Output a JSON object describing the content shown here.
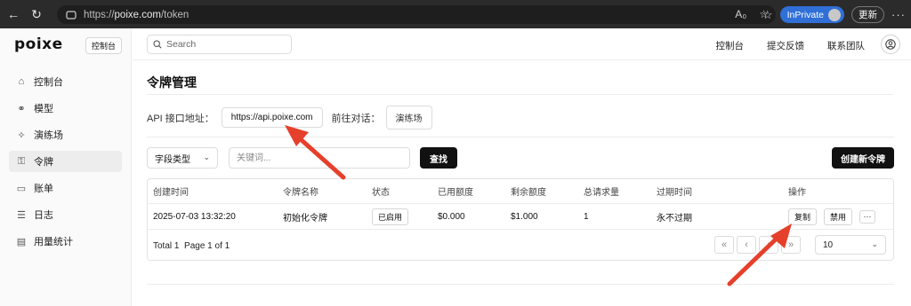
{
  "browser": {
    "url_scheme": "https://",
    "url_host": "poixe.com",
    "url_path": "/token",
    "inprivate_label": "InPrivate",
    "update_label": "更新"
  },
  "app": {
    "logo": "poixe",
    "console_badge": "控制台"
  },
  "sidebar": {
    "items": [
      {
        "label": "控制台",
        "icon": "home-icon"
      },
      {
        "label": "模型",
        "icon": "models-icon"
      },
      {
        "label": "演练场",
        "icon": "sparkle-icon"
      },
      {
        "label": "令牌",
        "icon": "key-icon"
      },
      {
        "label": "账单",
        "icon": "card-icon"
      },
      {
        "label": "日志",
        "icon": "list-icon"
      },
      {
        "label": "用量统计",
        "icon": "chart-icon"
      }
    ]
  },
  "topbar": {
    "search_placeholder": "Search",
    "links": [
      "控制台",
      "提交反馈",
      "联系团队"
    ]
  },
  "page": {
    "title": "令牌管理",
    "api_label": "API 接口地址：",
    "api_url": "https://api.poixe.com",
    "goto_label": "前往对话：",
    "playground_button": "演练场"
  },
  "filters": {
    "field_type": "字段类型",
    "keyword_placeholder": "关键词...",
    "search_button": "查找",
    "create_button": "创建新令牌"
  },
  "table": {
    "columns": [
      "创建时间",
      "令牌名称",
      "状态",
      "已用额度",
      "剩余额度",
      "总请求量",
      "过期时间",
      "操作"
    ],
    "rows": [
      {
        "created": "2025-07-03 13:32:20",
        "name": "初始化令牌",
        "status": "已启用",
        "used": "$0.000",
        "remaining": "$1.000",
        "requests": "1",
        "expires": "永不过期",
        "actions": [
          "复制",
          "禁用",
          "···"
        ]
      }
    ],
    "footer_total": "Total 1",
    "footer_page": "Page 1 of 1",
    "page_size": "10"
  },
  "colors": {
    "annotation_arrow": "#e5402b",
    "inprivate": "#2f6fd6",
    "primary_button": "#111111"
  }
}
